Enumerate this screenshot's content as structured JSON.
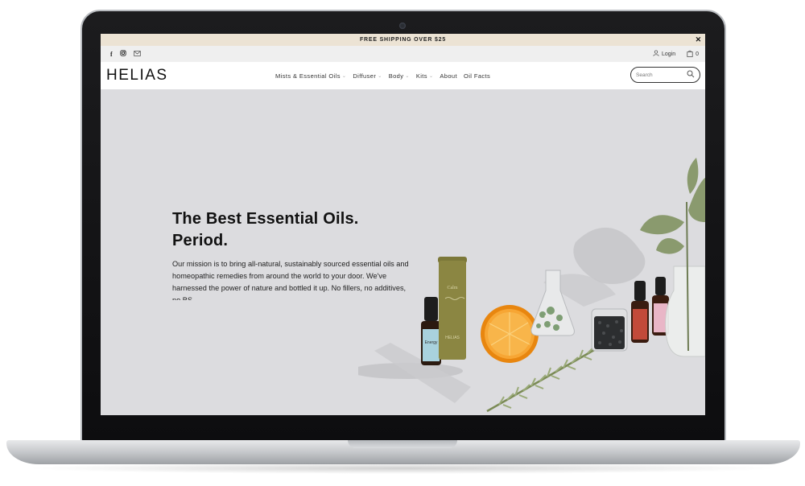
{
  "announcement": {
    "text": "FREE SHIPPING OVER $25",
    "close_icon": "close-icon"
  },
  "utility": {
    "social_icons": [
      "facebook-icon",
      "instagram-icon",
      "email-icon"
    ],
    "login_label": "Login",
    "cart_count": "0"
  },
  "header": {
    "logo": "HELIAS",
    "nav": [
      {
        "label": "Mists & Essential Oils",
        "dropdown": true
      },
      {
        "label": "Diffuser",
        "dropdown": true
      },
      {
        "label": "Body",
        "dropdown": true
      },
      {
        "label": "Kits",
        "dropdown": true
      },
      {
        "label": "About",
        "dropdown": false
      },
      {
        "label": "Oil Facts",
        "dropdown": false
      }
    ],
    "search_placeholder": "Search"
  },
  "hero": {
    "title_line1": "The Best Essential Oils.",
    "title_line2": "Period.",
    "body": "Our mission is to bring all-natural, sustainably sourced essential oils and homeopathic remedies from around the world to your door. We've harnessed the power of nature and bottled it up. No fillers, no additives, no BS.",
    "product_labels": {
      "tube": "Calm",
      "tube_brand": "HELIAS",
      "bottle": "Energy"
    }
  },
  "colors": {
    "announce_bg": "#ece3d4",
    "hero_bg": "#dcdcdf",
    "orange": "#f39a1c",
    "olive": "#8b8642"
  }
}
